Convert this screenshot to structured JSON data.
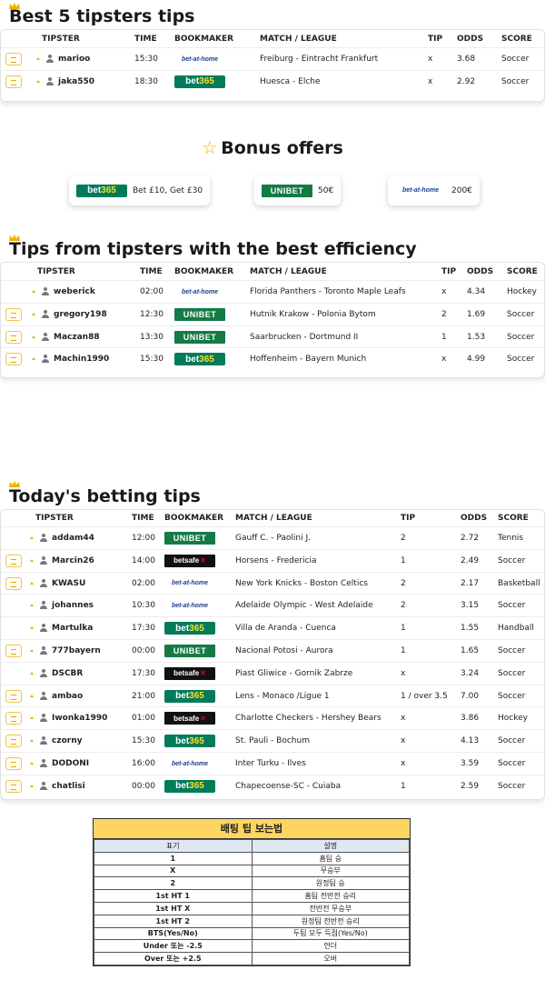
{
  "headers": {
    "tipster": "TIPSTER",
    "time": "TIME",
    "bookmaker": "BOOKMAKER",
    "match": "MATCH / LEAGUE",
    "tip": "TIP",
    "odds": "ODDS",
    "score": "SCORE"
  },
  "sections": {
    "best5": {
      "title": "Best 5 tipsters tips",
      "rows": [
        {
          "tipster": "marioo",
          "time": "15:30",
          "bookmaker": "bet-at-home",
          "match": "Freiburg - Eintracht Frankfurt",
          "tip": "x",
          "odds": "3.68",
          "score": "Soccer",
          "button": true
        },
        {
          "tipster": "jaka550",
          "time": "18:30",
          "bookmaker": "bet365",
          "match": "Huesca - Elche",
          "tip": "x",
          "odds": "2.92",
          "score": "Soccer",
          "button": true
        }
      ]
    },
    "efficiency": {
      "title": "Tips from tipsters with the best efficiency",
      "rows": [
        {
          "tipster": "weberick",
          "time": "02:00",
          "bookmaker": "bet-at-home",
          "match": "Florida Panthers - Toronto Maple Leafs",
          "tip": "x",
          "odds": "4.34",
          "score": "Hockey",
          "button": false
        },
        {
          "tipster": "gregory198",
          "time": "12:30",
          "bookmaker": "unibet",
          "match": "Hutnik Krakow - Polonia Bytom",
          "tip": "2",
          "odds": "1.69",
          "score": "Soccer",
          "button": true
        },
        {
          "tipster": "Maczan88",
          "time": "13:30",
          "bookmaker": "unibet",
          "match": "Saarbrucken - Dortmund II",
          "tip": "1",
          "odds": "1.53",
          "score": "Soccer",
          "button": true
        },
        {
          "tipster": "Machin1990",
          "time": "15:30",
          "bookmaker": "bet365",
          "match": "Hoffenheim - Bayern Munich",
          "tip": "x",
          "odds": "4.99",
          "score": "Soccer",
          "button": true
        }
      ]
    },
    "today": {
      "title": "Today's betting tips",
      "rows": [
        {
          "tipster": "addam44",
          "time": "12:00",
          "bookmaker": "unibet",
          "match": "Gauff C. - Paolini J.",
          "tip": "2",
          "odds": "2.72",
          "score": "Tennis",
          "button": false
        },
        {
          "tipster": "Marcin26",
          "time": "14:00",
          "bookmaker": "betsafe",
          "match": "Horsens - Fredericia",
          "tip": "1",
          "odds": "2.49",
          "score": "Soccer",
          "button": true
        },
        {
          "tipster": "KWASU",
          "time": "02:00",
          "bookmaker": "bet-at-home",
          "match": "New York Knicks - Boston Celtics",
          "tip": "2",
          "odds": "2.17",
          "score": "Basketball",
          "button": true
        },
        {
          "tipster": "johannes",
          "time": "10:30",
          "bookmaker": "bet-at-home",
          "match": "Adelaide Olympic - West Adelaide",
          "tip": "2",
          "odds": "3.15",
          "score": "Soccer",
          "button": false
        },
        {
          "tipster": "Martulka",
          "time": "17:30",
          "bookmaker": "bet365",
          "match": "Villa de Aranda - Cuenca",
          "tip": "1",
          "odds": "1.55",
          "score": "Handball",
          "button": false
        },
        {
          "tipster": "777bayern",
          "time": "00:00",
          "bookmaker": "unibet",
          "match": "Nacional Potosi - Aurora",
          "tip": "1",
          "odds": "1.65",
          "score": "Soccer",
          "button": true
        },
        {
          "tipster": "DSCBR",
          "time": "17:30",
          "bookmaker": "betsafe",
          "match": "Piast Gliwice - Gornik Zabrze",
          "tip": "x",
          "odds": "3.24",
          "score": "Soccer",
          "button": false
        },
        {
          "tipster": "ambao",
          "time": "21:00",
          "bookmaker": "bet365",
          "match": "Lens - Monaco /Ligue 1",
          "tip": "1 / over 3.5",
          "odds": "7.00",
          "score": "Soccer",
          "button": true
        },
        {
          "tipster": "Iwonka1990",
          "time": "01:00",
          "bookmaker": "betsafe",
          "match": "Charlotte Checkers - Hershey Bears",
          "tip": "x",
          "odds": "3.86",
          "score": "Hockey",
          "button": true
        },
        {
          "tipster": "czorny",
          "time": "15:30",
          "bookmaker": "bet365",
          "match": "St. Pauli - Bochum",
          "tip": "x",
          "odds": "4.13",
          "score": "Soccer",
          "button": true
        },
        {
          "tipster": "DODONI",
          "time": "16:00",
          "bookmaker": "bet-at-home",
          "match": "Inter Turku - Ilves",
          "tip": "x",
          "odds": "3.59",
          "score": "Soccer",
          "button": true
        },
        {
          "tipster": "chatlisi",
          "time": "00:00",
          "bookmaker": "bet365",
          "match": "Chapecoense-SC - Cuiaba",
          "tip": "1",
          "odds": "2.59",
          "score": "Soccer",
          "button": true
        }
      ]
    }
  },
  "bonus": {
    "title": "Bonus offers",
    "star": "☆",
    "offers": [
      {
        "bookmaker": "bet365",
        "text": "Bet £10, Get £30"
      },
      {
        "bookmaker": "unibet",
        "text": "50€"
      },
      {
        "bookmaker": "bet-at-home",
        "text": "200€"
      }
    ]
  },
  "logos": {
    "bet365": {
      "main": "bet",
      "accent": "365"
    },
    "unibet": "UNIBET",
    "betathome": "bet-at-home",
    "betsafe": {
      "main": "betsafe",
      "accent": "✕"
    }
  },
  "legend": {
    "title": "배팅 팁 보는법",
    "col_key": "표기",
    "col_desc": "설명",
    "rows": [
      {
        "key": "1",
        "desc": "홈팀 승"
      },
      {
        "key": "X",
        "desc": "무승부"
      },
      {
        "key": "2",
        "desc": "원정팀 승"
      },
      {
        "key": "1st HT 1",
        "desc": "홈팀 전반전 승리"
      },
      {
        "key": "1st HT X",
        "desc": "전반전 무승부"
      },
      {
        "key": "1st HT 2",
        "desc": "원정팀 전반전 승리"
      },
      {
        "key": "BTS(Yes/No)",
        "desc": "두팀 모두 득점(Yes/No)"
      },
      {
        "key": "Under 또는 -2.5",
        "desc": "언더"
      },
      {
        "key": "Over 또는 +2.5",
        "desc": "오버"
      }
    ]
  },
  "colors": {
    "accent": "#e4b000",
    "bet365_green": "#027b5b",
    "unibet_green": "#147b45",
    "legend_header": "#fcd661"
  }
}
